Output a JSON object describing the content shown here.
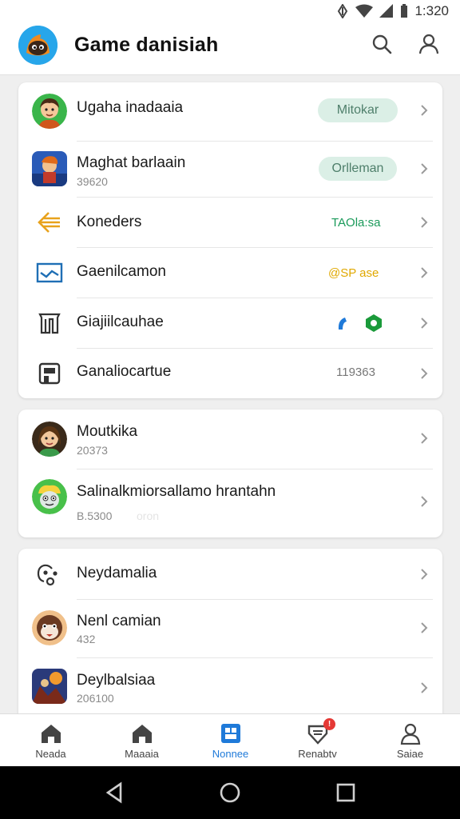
{
  "status_bar": {
    "time": "1:320"
  },
  "header": {
    "title": "Game danisiah",
    "logo_icon": "game-mascot-logo",
    "search_icon": "search-icon",
    "profile_icon": "profile-icon"
  },
  "group1": [
    {
      "title": "Ugaha inadaaia",
      "pill": "Mitokar",
      "icon": "avatar-boy"
    },
    {
      "title": "Maghat barlaain",
      "sub": "39620",
      "pill": "Orlleman",
      "icon": "game-app-icon"
    },
    {
      "title": "Koneders",
      "value": "TAOla:sa",
      "icon": "arrows-icon"
    },
    {
      "title": "Gaenilcamon",
      "value": "@SP ase",
      "icon": "envelope-icon"
    },
    {
      "title": "Giajiilcauhae",
      "value": "",
      "icon": "trash-icon"
    },
    {
      "title": "Ganaliocartue",
      "value": "119363",
      "icon": "device-icon"
    }
  ],
  "group2": [
    {
      "title": "Moutkika",
      "sub": "20373",
      "icon": "avatar-girl"
    },
    {
      "title": "Salinalkmiorsallamo hrantahn",
      "sub": "B.5300",
      "sub_faint": "oron",
      "icon": "avatar-cartoon"
    }
  ],
  "group3": [
    {
      "title": "Neydamalia",
      "icon": "people-icon"
    },
    {
      "title": "Nenl camian",
      "sub": "432",
      "icon": "avatar-animal"
    },
    {
      "title": "Deylbalsiaa",
      "sub": "206100",
      "icon": "game-art-icon"
    }
  ],
  "bottom_nav": [
    {
      "label": "Neada",
      "icon": "home-icon",
      "active": false
    },
    {
      "label": "Maaaia",
      "icon": "home-icon",
      "active": false
    },
    {
      "label": "Nonnee",
      "icon": "grid-icon",
      "active": true
    },
    {
      "label": "Renabtv",
      "icon": "shield-icon",
      "active": false,
      "badge": "!"
    },
    {
      "label": "Saiae",
      "icon": "user-icon",
      "active": false
    }
  ],
  "colors": {
    "accent": "#1f7ad9",
    "pill_bg": "#dbefe6",
    "green_value": "#1a9a5a",
    "yellow_value": "#e0a800"
  }
}
